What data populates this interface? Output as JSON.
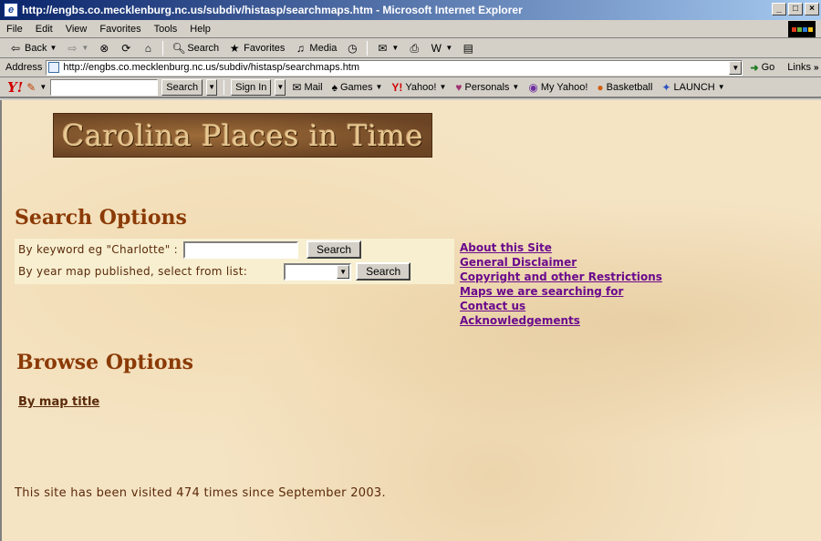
{
  "window": {
    "title": "http://engbs.co.mecklenburg.nc.us/subdiv/histasp/searchmaps.htm - Microsoft Internet Explorer",
    "minimize": "_",
    "maximize": "□",
    "close": "×"
  },
  "menu": [
    "File",
    "Edit",
    "View",
    "Favorites",
    "Tools",
    "Help"
  ],
  "toolbar": {
    "back": "Back",
    "search": "Search",
    "favorites": "Favorites",
    "media": "Media"
  },
  "address": {
    "label": "Address",
    "url": "http://engbs.co.mecklenburg.nc.us/subdiv/histasp/searchmaps.htm",
    "go": "Go",
    "links": "Links"
  },
  "yahoo_bar": {
    "logo": "Y!",
    "search_button": "Search",
    "sign_in": "Sign In",
    "items": [
      "Mail",
      "Games",
      "Yahoo!",
      "Personals",
      "My Yahoo!",
      "Basketball",
      "LAUNCH"
    ]
  },
  "page": {
    "banner": "Carolina Places in Time",
    "search_heading": "Search Options",
    "keyword_label": "By keyword eg \"Charlotte\" :",
    "keyword_button": "Search",
    "year_label": "By year map published, select from list:",
    "year_button": "Search",
    "side_links": [
      "About this Site",
      "General Disclaimer",
      "Copyright and other Restrictions",
      "Maps we are searching for",
      "Contact us",
      "Acknowledgements"
    ],
    "browse_heading": "Browse Options",
    "browse_link": "By map title",
    "visit_text": "This site has been visited 474 times since September 2003."
  },
  "colors": {
    "heading": "#8b3a06",
    "link": "#6a0a8c",
    "parchment": "#f5e4c4"
  }
}
